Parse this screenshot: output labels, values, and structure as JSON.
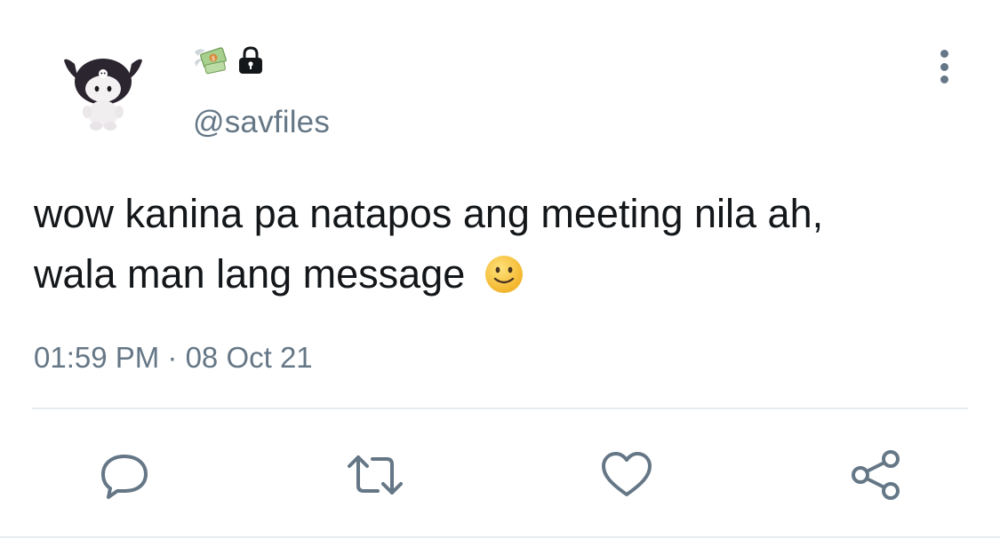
{
  "tweet": {
    "handle": "@savfiles",
    "name_icons": [
      "money-with-wings-icon",
      "lock-icon"
    ],
    "text_line1": "wow kanina pa natapos ang meeting nila ah,",
    "text_line2": "wala man lang message",
    "emoji": "slightly-smiling-face-icon",
    "timestamp": "01:59 PM · 08 Oct 21"
  },
  "actions": [
    "reply-icon",
    "retweet-icon",
    "like-icon",
    "share-icon"
  ],
  "colors": {
    "text": "#14171a",
    "secondary": "#657786",
    "divider": "#e6ecf0",
    "emoji_face": "#f7c63c"
  }
}
